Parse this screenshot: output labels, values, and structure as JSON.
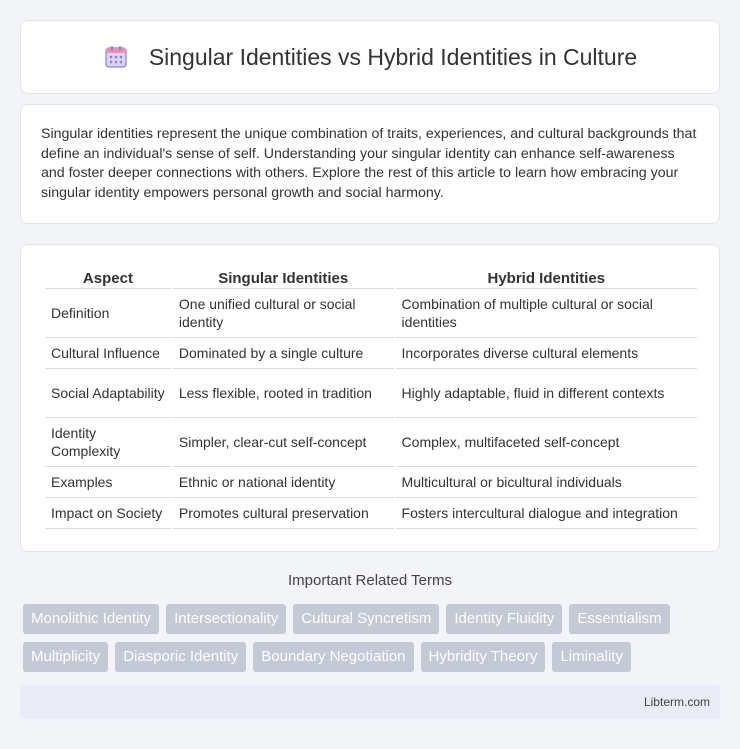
{
  "header": {
    "title": "Singular Identities vs Hybrid Identities in Culture",
    "icon": "calendar-icon"
  },
  "intro": {
    "text": "Singular identities represent the unique combination of traits, experiences, and cultural backgrounds that define an individual's sense of self. Understanding your singular identity can enhance self-awareness and foster deeper connections with others. Explore the rest of this article to learn how embracing your singular identity empowers personal growth and social harmony."
  },
  "table": {
    "headers": [
      "Aspect",
      "Singular Identities",
      "Hybrid Identities"
    ],
    "rows": [
      [
        "Definition",
        "One unified cultural or social identity",
        "Combination of multiple cultural or social identities"
      ],
      [
        "Cultural Influence",
        "Dominated by a single culture",
        "Incorporates diverse cultural elements"
      ],
      [
        "Social Adaptability",
        "Less flexible, rooted in tradition",
        "Highly adaptable, fluid in different contexts"
      ],
      [
        "Identity Complexity",
        "Simpler, clear-cut self-concept",
        "Complex, multifaceted self-concept"
      ],
      [
        "Examples",
        "Ethnic or national identity",
        "Multicultural or bicultural individuals"
      ],
      [
        "Impact on Society",
        "Promotes cultural preservation",
        "Fosters intercultural dialogue and integration"
      ]
    ]
  },
  "related": {
    "title": "Important Related Terms",
    "row1": [
      "Monolithic Identity",
      "Intersectionality",
      "Cultural Syncretism",
      "Identity Fluidity",
      "Essentialism"
    ],
    "row2": [
      "Multiplicity",
      "Diasporic Identity",
      "Boundary Negotiation",
      "Hybridity Theory",
      "Liminality"
    ]
  },
  "footer": {
    "brand": "Libterm.com"
  },
  "colors": {
    "background": "#f3f4f8",
    "tag": "#c4c9d6",
    "footer": "#e9ecf6",
    "icon_purple": "#8b7fd6",
    "icon_pink": "#f08db0"
  }
}
